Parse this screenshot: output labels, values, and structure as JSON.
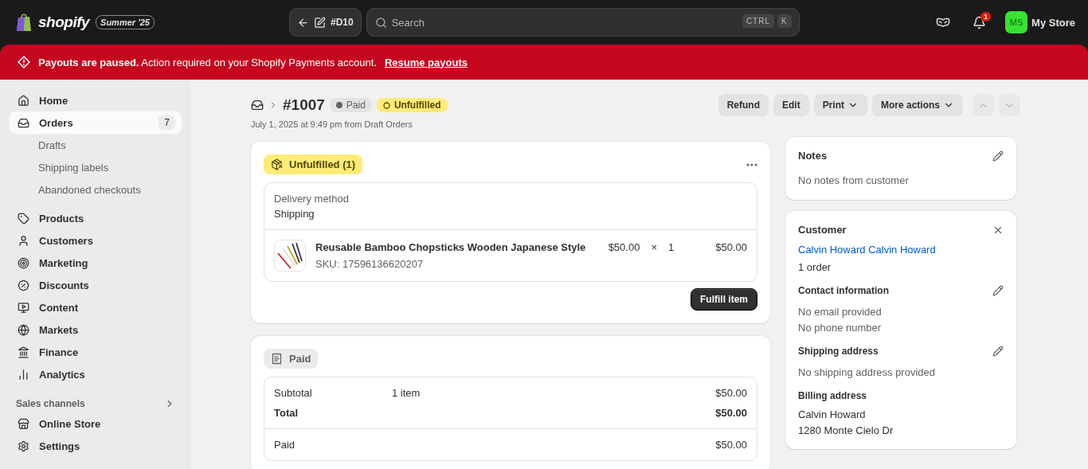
{
  "topbar": {
    "brand": {
      "name": "shopify",
      "edition": "Summer '25"
    },
    "back_button": {
      "label": "#D10"
    },
    "search": {
      "placeholder": "Search",
      "shortcut": [
        "CTRL",
        "K"
      ]
    },
    "notifications": {
      "count": "1"
    },
    "store": {
      "initials": "MS",
      "name": "My Store"
    }
  },
  "banner": {
    "text": "**Payouts are paused.** Action required on your Shopify Payments account.",
    "link": "Resume payouts"
  },
  "sidebar": {
    "items": [
      {
        "label": "Home",
        "selected": false
      },
      {
        "label": "Orders",
        "selected": true,
        "badge": "7",
        "children": [
          {
            "label": "Drafts",
            "selected": false
          },
          {
            "label": "Shipping labels",
            "selected": false
          },
          {
            "label": "Abandoned checkouts",
            "selected": false
          }
        ]
      },
      {
        "label": "Products",
        "selected": false
      },
      {
        "label": "Customers",
        "selected": false
      },
      {
        "label": "Marketing",
        "selected": false
      },
      {
        "label": "Discounts",
        "selected": false
      },
      {
        "label": "Content",
        "selected": false
      },
      {
        "label": "Markets",
        "selected": false
      },
      {
        "label": "Finance",
        "selected": false
      },
      {
        "label": "Analytics",
        "selected": false
      }
    ],
    "sales_channels": {
      "label": "Sales channels",
      "items": [
        {
          "label": "Online Store",
          "selected": false
        }
      ]
    },
    "settings": {
      "label": "Settings"
    }
  },
  "order": {
    "number": "#1007",
    "badges": [
      {
        "label": "Paid",
        "kind": "paid"
      },
      {
        "label": "Unfulfilled",
        "kind": "unfulfilled"
      }
    ],
    "subtitle": "July 1, 2025 at 9:49 pm from Draft Orders",
    "actions": [
      {
        "label": "Refund",
        "dropdown": false
      },
      {
        "label": "Edit",
        "dropdown": false
      },
      {
        "label": "Print",
        "dropdown": true
      },
      {
        "label": "More actions",
        "dropdown": true
      }
    ],
    "nav": {
      "previous_disabled": true,
      "next_disabled": true
    }
  },
  "fulfillment": {
    "status": "Unfulfilled (1)",
    "delivery_label": "Delivery method",
    "delivery_value": "Shipping",
    "line_item": {
      "name": "Reusable Bamboo Chopsticks Wooden Japanese Style",
      "sku": "SKU: 17596136620207",
      "price": "$50.00",
      "times": "×",
      "quantity": "1",
      "total": "$50.00"
    },
    "button": "Fulfill item"
  },
  "payment": {
    "status": "Paid",
    "rows": [
      {
        "kind": "normal",
        "label": "Subtotal",
        "detail": "1 item",
        "amount": "$50.00"
      },
      {
        "kind": "total",
        "label": "Total",
        "amount": "$50.00"
      },
      {
        "kind": "divided",
        "label": "Paid",
        "amount": "$50.00"
      }
    ]
  },
  "notes": {
    "title": "Notes",
    "text": "No notes from customer"
  },
  "customer": {
    "title": "Customer",
    "name": "Calvin Howard Calvin Howard",
    "orders": "1 order",
    "sections": [
      {
        "title": "Contact information",
        "editable": true,
        "lines": [
          "No email provided",
          "No phone number"
        ]
      },
      {
        "title": "Shipping address",
        "editable": true,
        "lines": [
          "No shipping address provided"
        ]
      },
      {
        "title": "Billing address",
        "editable": false,
        "lines": [
          "Calvin Howard",
          "1280 Monte Cielo Dr"
        ]
      }
    ]
  }
}
